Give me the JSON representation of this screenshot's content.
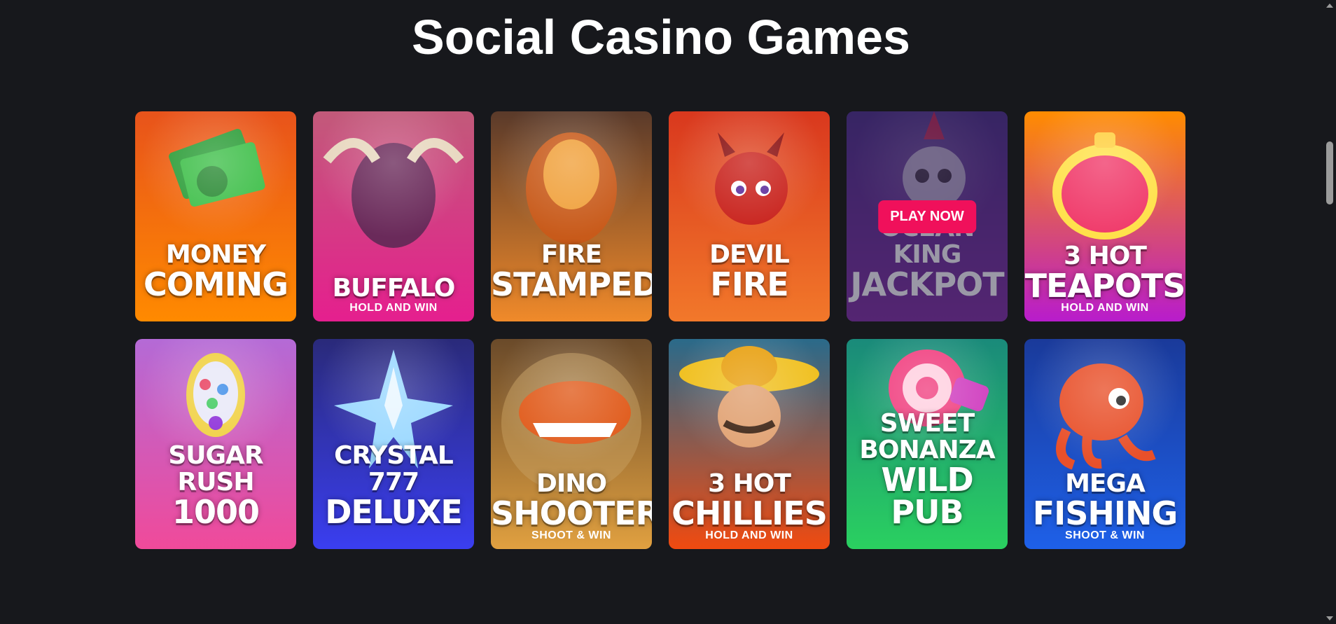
{
  "page": {
    "title": "Social Casino Games"
  },
  "hover_action_label": "PLAY NOW",
  "games": [
    {
      "line1": "MONEY",
      "line2": "COMING",
      "subtitle": "",
      "theme": "money",
      "c1": "#e8531b",
      "c2": "#ff8a00"
    },
    {
      "line1": "BUFFALO",
      "line2": "",
      "subtitle": "HOLD AND WIN",
      "theme": "buffalo",
      "c1": "#c25a7a",
      "c2": "#e51f8e"
    },
    {
      "line1": "FIRE",
      "line2": "STAMPEDE",
      "subtitle": "",
      "theme": "fire",
      "c1": "#5a3a2a",
      "c2": "#f08a2a"
    },
    {
      "line1": "DEVIL",
      "line2": "FIRE",
      "subtitle": "",
      "theme": "devil",
      "c1": "#d9381e",
      "c2": "#f2782a"
    },
    {
      "line1": "OCEAN KING",
      "line2": "JACKPOT",
      "subtitle": "",
      "theme": "ocean",
      "c1": "#4a3a8a",
      "c2": "#8a3aa8",
      "hovered": true
    },
    {
      "line1": "3 HOT",
      "line2": "TEAPOTS",
      "subtitle": "HOLD AND WIN",
      "theme": "teapot",
      "c1": "#ff8c00",
      "c2": "#b81ccc"
    },
    {
      "line1": "SUGAR RUSH",
      "line2": "1000",
      "subtitle": "",
      "theme": "sugar",
      "c1": "#b46ad6",
      "c2": "#f04a9a"
    },
    {
      "line1": "CRYSTAL 777",
      "line2": "DELUXE",
      "subtitle": "",
      "theme": "crystal",
      "c1": "#2a2a7a",
      "c2": "#3a3ef0"
    },
    {
      "line1": "DINO",
      "line2": "SHOOTER",
      "subtitle": "SHOOT & WIN",
      "theme": "dino",
      "c1": "#6a4a2a",
      "c2": "#e0a040"
    },
    {
      "line1": "3 HOT",
      "line2": "CHILLIES",
      "subtitle": "HOLD AND WIN",
      "theme": "chillies",
      "c1": "#2a6a8a",
      "c2": "#f04a10"
    },
    {
      "line1": "SWEET BONANZA",
      "line2": "WILD PUB",
      "subtitle": "",
      "theme": "sweet",
      "c1": "#1a8a7a",
      "c2": "#2ad060"
    },
    {
      "line1": "MEGA",
      "line2": "FISHING",
      "subtitle": "SHOOT & WIN",
      "theme": "fishing",
      "c1": "#1a3a9a",
      "c2": "#1e60e8"
    }
  ],
  "colors": {
    "background": "#17181c",
    "play_button": "#f0105b"
  }
}
